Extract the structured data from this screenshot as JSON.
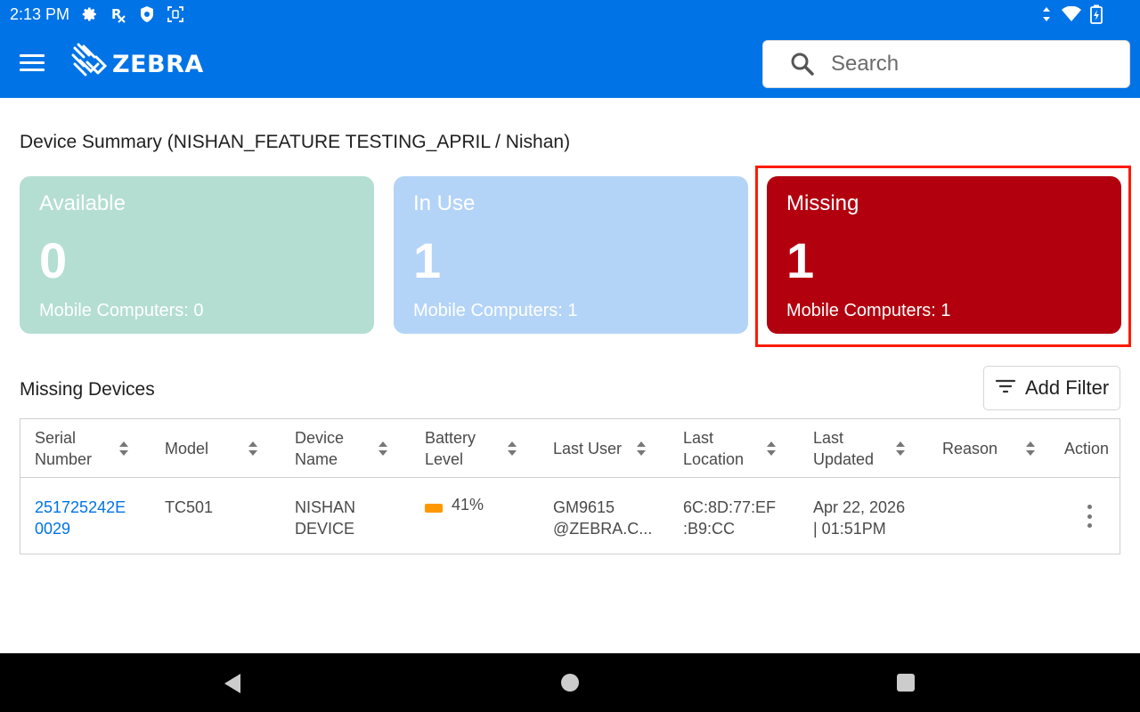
{
  "status_bar": {
    "time": "2:13 PM",
    "left_icons": [
      "settings-icon",
      "rx-icon",
      "shield-icon",
      "screenshot-icon"
    ],
    "right_icons": [
      "data-arrows-icon",
      "wifi-icon",
      "battery-charging-icon"
    ]
  },
  "app_bar": {
    "logo_text": "ZEBRA",
    "search": {
      "placeholder": "Search",
      "value": ""
    }
  },
  "summary": {
    "title": "Device Summary (NISHAN_FEATURE TESTING_APRIL / Nishan)",
    "cards": [
      {
        "label": "Available",
        "count": "0",
        "sub": "Mobile Computers: 0",
        "color": "#b4ded1"
      },
      {
        "label": "In Use",
        "count": "1",
        "sub": "Mobile Computers: 1",
        "color": "#b4d4f7"
      },
      {
        "label": "Missing",
        "count": "1",
        "sub": "Mobile Computers: 1",
        "color": "#b3000f"
      }
    ],
    "highlight_color": "#ff1a00"
  },
  "missing_devices": {
    "title": "Missing Devices",
    "add_filter_label": "Add Filter",
    "columns": [
      {
        "label": "Serial\nNumber",
        "sortable": true
      },
      {
        "label": "Model",
        "sortable": true
      },
      {
        "label": "Device\nName",
        "sortable": true
      },
      {
        "label": "Battery\nLevel",
        "sortable": true
      },
      {
        "label": "Last User",
        "sortable": true
      },
      {
        "label": "Last\nLocation",
        "sortable": true
      },
      {
        "label": "Last\nUpdated",
        "sortable": true
      },
      {
        "label": "Reason",
        "sortable": true
      },
      {
        "label": "Action",
        "sortable": false
      }
    ],
    "rows": [
      {
        "serial": "251725242E\n0029",
        "model": "TC501",
        "device_name": "NISHAN\nDEVICE",
        "battery": "41%",
        "battery_color": "#ff9800",
        "last_user": "GM9615\n@ZEBRA.C...",
        "last_location": "6C:8D:77:EF\n:B9:CC",
        "last_updated": "Apr 22, 2026\n| 01:51PM",
        "reason": ""
      }
    ]
  },
  "colors": {
    "brand_blue": "#0073e6",
    "link": "#0073e6"
  }
}
